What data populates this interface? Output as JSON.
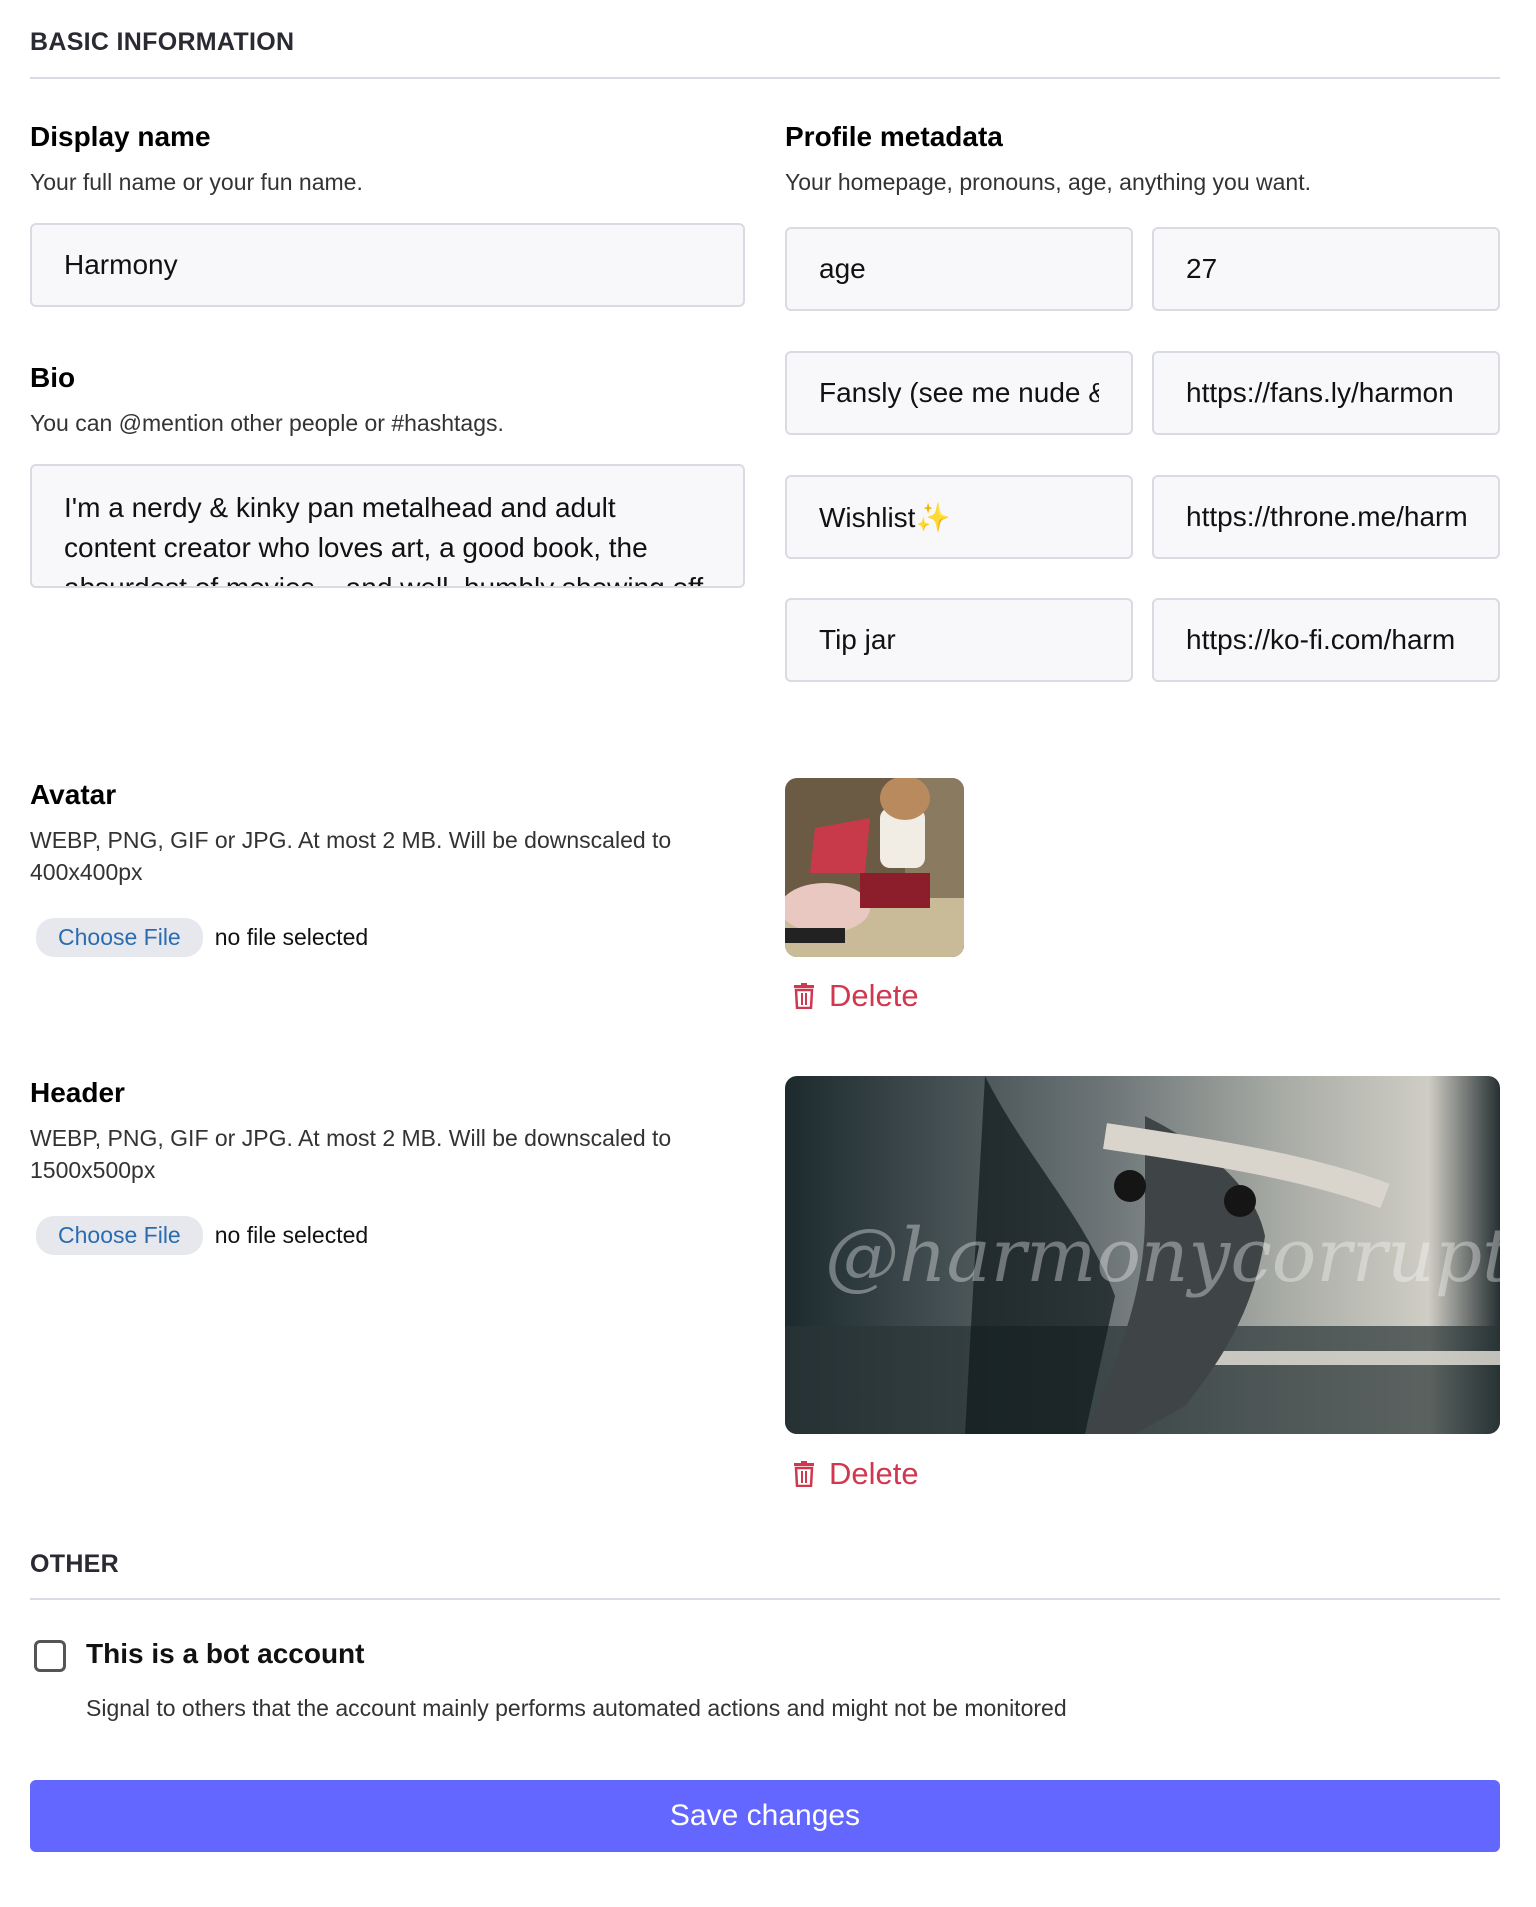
{
  "sections": {
    "basic": "BASIC INFORMATION",
    "other": "OTHER"
  },
  "display_name": {
    "label": "Display name",
    "hint": "Your full name or your fun name.",
    "value": "Harmony"
  },
  "bio": {
    "label": "Bio",
    "hint": "You can @mention other people or #hashtags.",
    "value": "I'm a nerdy & kinky pan metalhead and adult content creator who loves art, a good book, the absurdest of movies... and well, humbly showing off my ASSets"
  },
  "metadata": {
    "label": "Profile metadata",
    "hint": "Your homepage, pronouns, age, anything you want.",
    "rows": [
      {
        "name": "age",
        "value": "27"
      },
      {
        "name": "Fansly (see me nude &",
        "value": "https://fans.ly/harmon"
      },
      {
        "name": "Wishlist✨",
        "value": "https://throne.me/harm"
      },
      {
        "name": "Tip jar",
        "value": "https://ko-fi.com/harm"
      }
    ]
  },
  "avatar": {
    "label": "Avatar",
    "hint": "WEBP, PNG, GIF or JPG. At most 2 MB. Will be downscaled to 400x400px",
    "choose_label": "Choose File",
    "file_status": "no file selected",
    "delete_label": "Delete"
  },
  "header": {
    "label": "Header",
    "hint": "WEBP, PNG, GIF or JPG. At most 2 MB. Will be downscaled to 1500x500px",
    "choose_label": "Choose File",
    "file_status": "no file selected",
    "delete_label": "Delete",
    "watermark": "@harmonycorrupted"
  },
  "bot": {
    "label": "This is a bot account",
    "hint": "Signal to others that the account mainly performs automated actions and might not be monitored",
    "checked": false
  },
  "save_label": "Save changes",
  "colors": {
    "accent": "#6366ff",
    "danger": "#d0384f",
    "link": "#2b6cb0"
  }
}
